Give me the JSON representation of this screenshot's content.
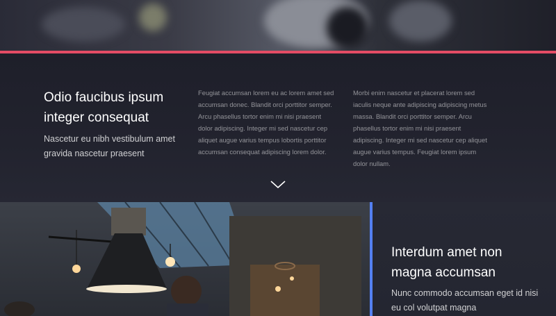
{
  "intro": {
    "title": "Odio faucibus ipsum integer consequat",
    "subtitle": "Nascetur eu nibh vestibulum amet gravida nascetur praesent",
    "column_a": "Feugiat accumsan lorem eu ac lorem amet sed accumsan donec. Blandit orci porttitor semper. Arcu phasellus tortor enim mi nisi praesent dolor adipiscing. Integer mi sed nascetur cep aliquet augue varius tempus lobortis porttitor accumsan consequat adipiscing lorem dolor.",
    "column_b": "Morbi enim nascetur et placerat lorem sed iaculis neque ante adipiscing adipiscing metus massa. Blandit orci porttitor semper. Arcu phasellus tortor enim mi nisi praesent adipiscing. Integer mi sed nascetur cep aliquet augue varius tempus. Feugiat lorem ipsum dolor nullam."
  },
  "feature": {
    "title": "Interdum amet non magna accumsan",
    "subtitle": "Nunc commodo accumsan eget id nisi eu col volutpat magna"
  },
  "icons": {
    "scroll_down": "chevron-down-icon"
  },
  "colors": {
    "accent_red": "#e44c65",
    "accent_blue": "#5480f1",
    "background": "#1c1d26"
  }
}
